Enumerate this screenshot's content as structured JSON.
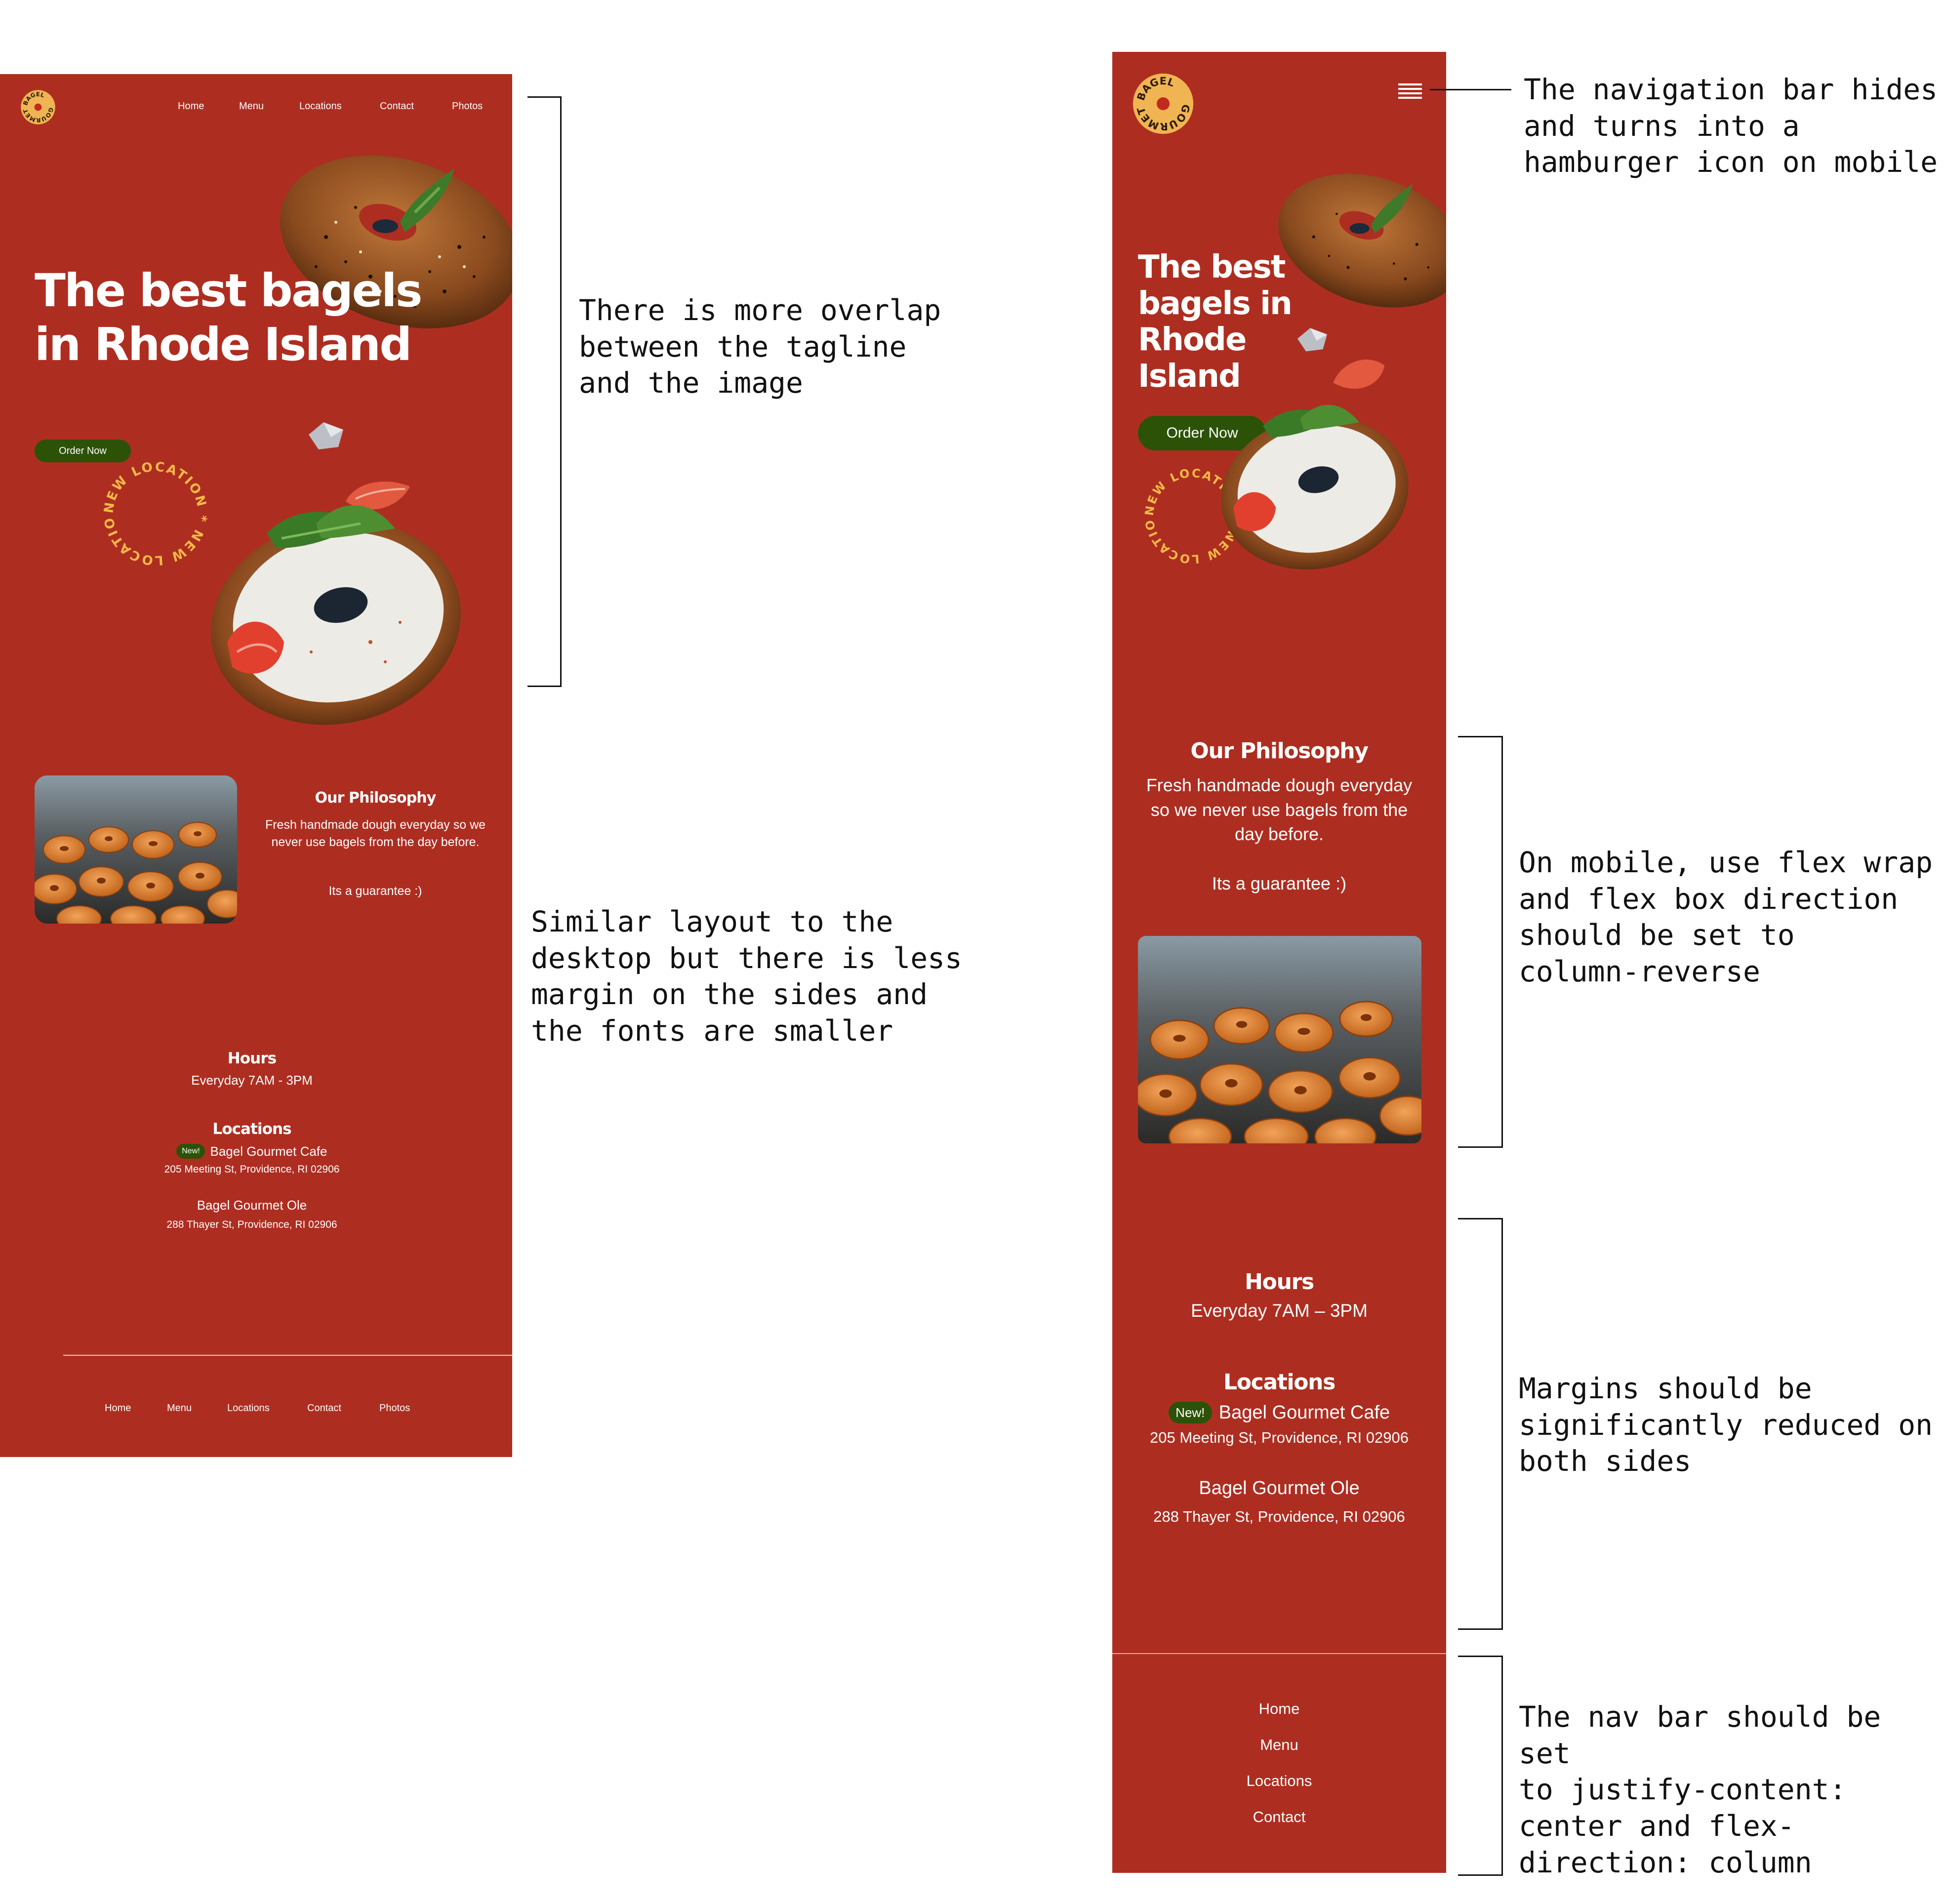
{
  "logo": {
    "text_top": "BAGEL",
    "text_bottom": "GOURMET"
  },
  "desktop": {
    "nav": [
      "Home",
      "Menu",
      "Locations",
      "Contact",
      "Photos"
    ],
    "hero_title": "The best bagels in Rhode Island",
    "order_button": "Order Now",
    "badge_text": "NEW LOCATION * NEW LOCATION *",
    "philosophy": {
      "title": "Our Philosophy",
      "body": "Fresh handmade dough everyday so we never use bagels from the day before.",
      "guarantee": "Its a guarantee :)"
    },
    "hours": {
      "title": "Hours",
      "value": "Everyday 7AM - 3PM"
    },
    "locations": {
      "title": "Locations",
      "new_badge": "New!",
      "items": [
        {
          "name": "Bagel Gourmet Cafe",
          "address": "205 Meeting St, Providence, RI 02906"
        },
        {
          "name": "Bagel Gourmet Ole",
          "address": "288 Thayer St, Providence, RI 02906"
        }
      ]
    },
    "footer_nav": [
      "Home",
      "Menu",
      "Locations",
      "Contact",
      "Photos"
    ]
  },
  "mobile": {
    "menu_icon": "hamburger-icon",
    "hero_title": "The best bagels in Rhode Island",
    "order_button": "Order Now",
    "badge_text": "NEW LOCATION * NEW LOCATION *",
    "philosophy": {
      "title": "Our Philosophy",
      "body": "Fresh handmade dough everyday so we never use bagels from the day before.",
      "guarantee": "Its a guarantee :)"
    },
    "hours": {
      "title": "Hours",
      "value": "Everyday 7AM – 3PM"
    },
    "locations": {
      "title": "Locations",
      "new_badge": "New!",
      "items": [
        {
          "name": "Bagel Gourmet Cafe",
          "address": "205 Meeting St, Providence, RI 02906"
        },
        {
          "name": "Bagel Gourmet Ole",
          "address": "288 Thayer St, Providence, RI 02906"
        }
      ]
    },
    "footer_nav": [
      "Home",
      "Menu",
      "Locations",
      "Contact"
    ]
  },
  "annotations": {
    "overlap": "There is more overlap\nbetween the tagline\nand the image",
    "layout": "Similar layout to the\ndesktop but there is less\nmargin on the sides and\nthe fonts are smaller",
    "navbar": "The navigation bar hides\nand turns into a\nhamburger icon on mobile",
    "flex_wrap": "On mobile, use flex wrap\nand flex box direction\nshould be set to\ncolumn-reverse",
    "margins": "Margins should be\nsignificantly reduced on\nboth sides",
    "footer_nav": "The nav bar should be set\nto justify-content:\ncenter and flex-\ndirection: column"
  },
  "colors": {
    "brand_red": "#ad2e21",
    "button_green": "#2c5208",
    "logo_yellow": "#f0b452",
    "badge_yellow": "#f5b948"
  }
}
